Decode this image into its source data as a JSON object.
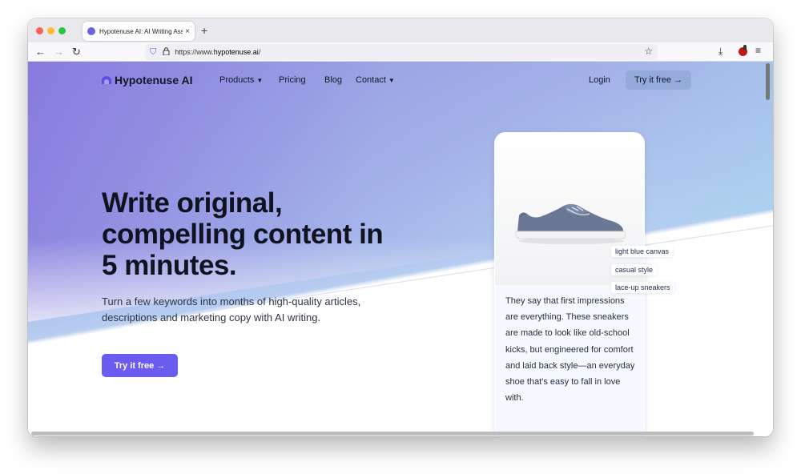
{
  "browser": {
    "tab_title": "Hypotenuse AI: AI Writing Assis",
    "tab_close": "×",
    "new_tab": "+",
    "url_prefix": "https://www.",
    "url_domain": "hypotenuse.ai",
    "url_suffix": "/"
  },
  "site": {
    "logo": "Hypotenuse AI",
    "nav": {
      "products": "Products",
      "pricing": "Pricing",
      "blog": "Blog",
      "contact": "Contact",
      "login": "Login",
      "try_free": "Try it free →"
    }
  },
  "hero": {
    "title_line1": "Write original,",
    "title_line2": "compelling content in",
    "title_line3": "5 minutes.",
    "subtitle_line1": "Turn a few keywords into months of high-quality articles,",
    "subtitle_line2": "descriptions and marketing copy with AI writing.",
    "cta": "Try it free →"
  },
  "card": {
    "tags": [
      "light blue canvas",
      "casual style",
      "lace-up sneakers"
    ],
    "description": "They say that first impressions are everything. These sneakers are made to look like old-school kicks, but engineered for comfort and laid back style—an everyday shoe that's easy to fall in love with."
  },
  "colors": {
    "brand": "#6a5cf0",
    "logo": "#5b4ee8",
    "text_dark": "#0f1320"
  }
}
